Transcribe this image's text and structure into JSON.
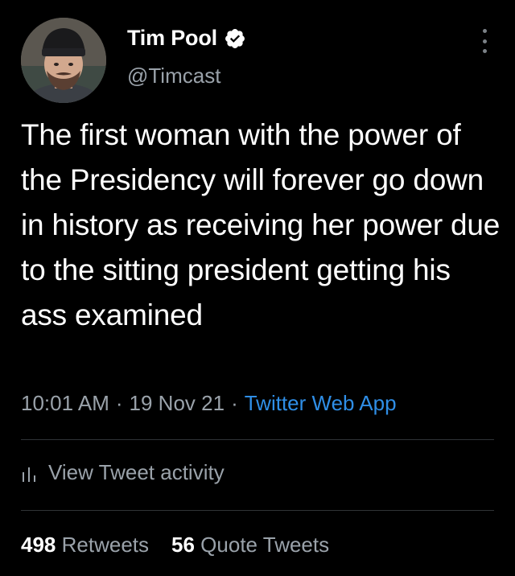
{
  "author": {
    "display_name": "Tim Pool",
    "handle": "@Timcast",
    "verified": true
  },
  "tweet": {
    "text": "The first woman with the power of the Presidency will forever go down in history as receiving her power due to the sitting president getting his ass examined",
    "time": "10:01 AM",
    "date": "19 Nov 21",
    "separator": "·",
    "source": "Twitter Web App"
  },
  "activity": {
    "label": "View Tweet activity",
    "icon": "bar-chart-icon"
  },
  "stats": {
    "retweets_count": "498",
    "retweets_label": "Retweets",
    "quotes_count": "56",
    "quotes_label": "Quote Tweets"
  },
  "colors": {
    "background": "#000000",
    "text_primary": "#ffffff",
    "text_secondary": "#9aa2aa",
    "link": "#2f8ee6",
    "divider": "#2f3336"
  }
}
